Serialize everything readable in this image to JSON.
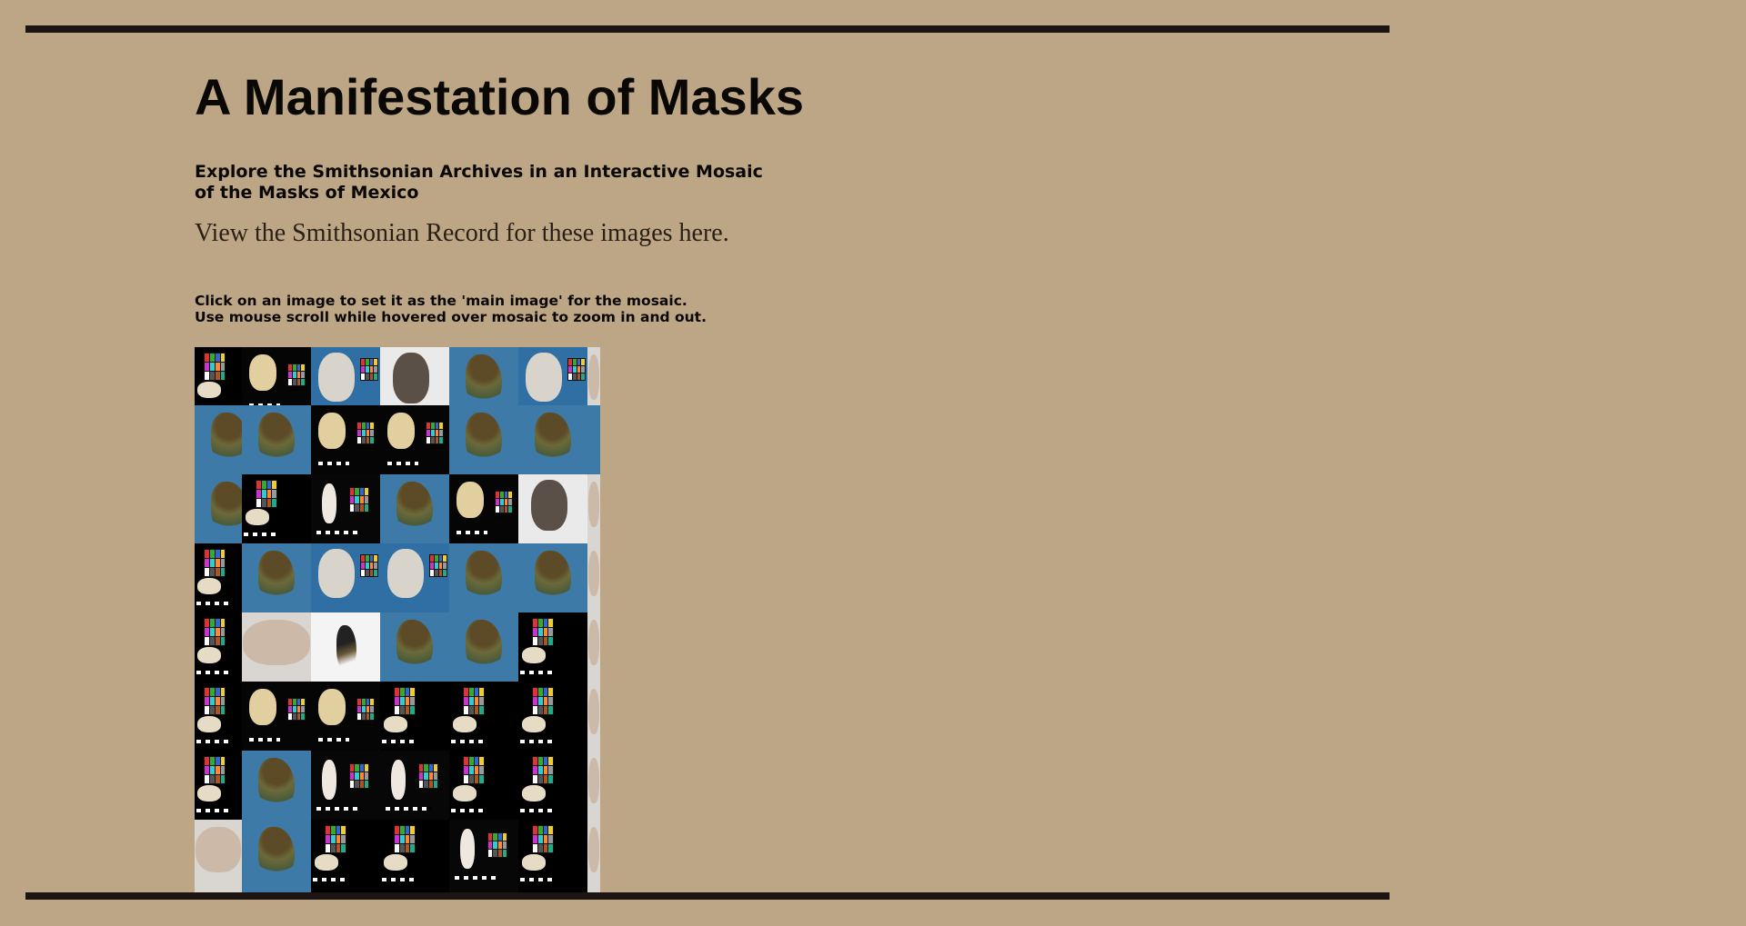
{
  "header": {
    "title": "A Manifestation of Masks",
    "subtitle": "Explore the Smithsonian Archives in an Interactive Mosaic of the Masks of Mexico",
    "record_link": "View the Smithsonian Record for these images here."
  },
  "instructions": {
    "line1": "Click on an image to set it as the 'main image' for the mosaic.",
    "line2": "Use mouse scroll while hovered over mosaic to zoom in and out."
  },
  "colors": {
    "background": "#bda685",
    "rule": "#1b1410",
    "text": "#0a0805"
  },
  "mosaic": {
    "tile_types": [
      "black-bg-mask",
      "blue-bg-plume-mask",
      "white-bg-mask",
      "gray-bg-mask"
    ]
  }
}
